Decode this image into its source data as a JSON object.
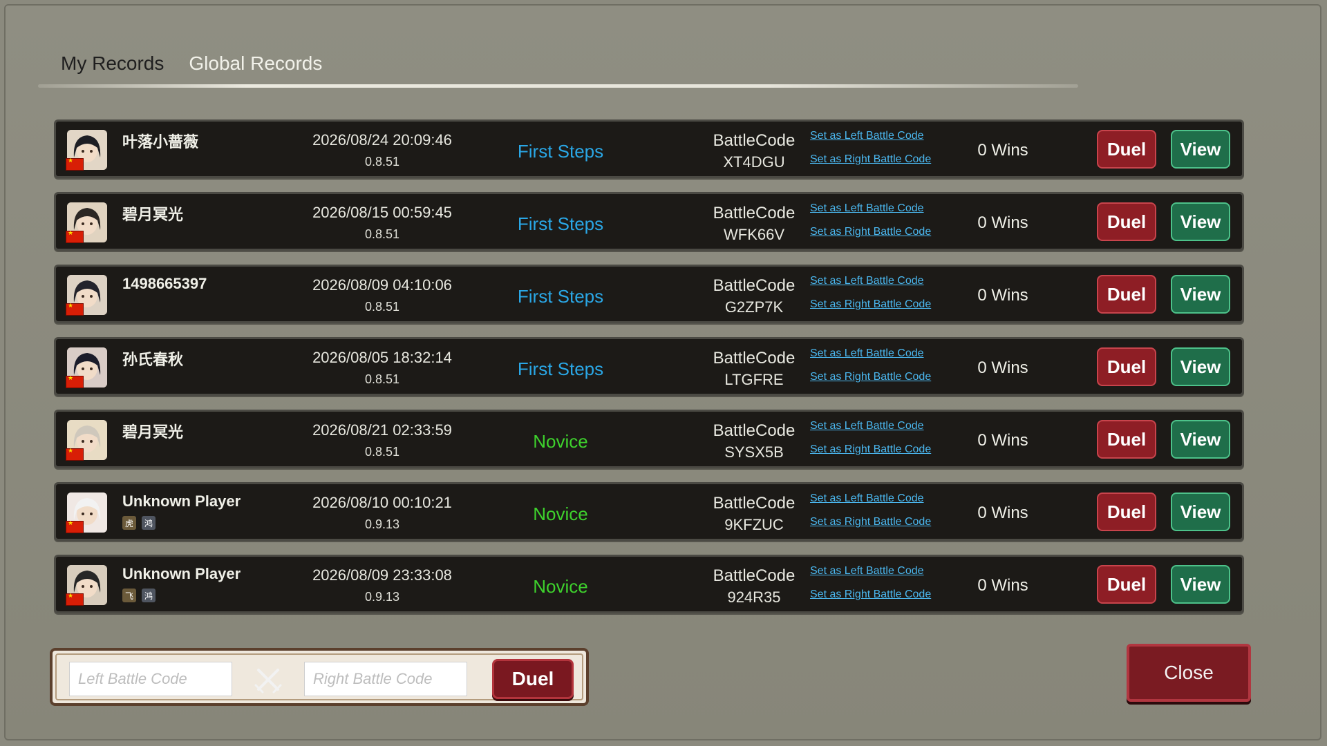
{
  "tabs": [
    {
      "label": "My Records",
      "active": true
    },
    {
      "label": "Global Records",
      "active": false
    }
  ],
  "records": [
    {
      "name": "叶落小蔷薇",
      "date": "2026/08/24 20:09:46",
      "version": "0.8.51",
      "rank": "First Steps",
      "rank_color": "#2aa7e6",
      "code_label": "BattleCode",
      "code": "XT4DGU",
      "set_left": "Set as Left Battle Code",
      "set_right": "Set as Right Battle Code",
      "wins": "0 Wins",
      "duel": "Duel",
      "view": "View",
      "avatar_bg": "#e2d6c6",
      "hair": "#1e1e24",
      "badges": []
    },
    {
      "name": "碧月冥光",
      "date": "2026/08/15 00:59:45",
      "version": "0.8.51",
      "rank": "First Steps",
      "rank_color": "#2aa7e6",
      "code_label": "BattleCode",
      "code": "WFK66V",
      "set_left": "Set as Left Battle Code",
      "set_right": "Set as Right Battle Code",
      "wins": "0 Wins",
      "duel": "Duel",
      "view": "View",
      "avatar_bg": "#e0d3c0",
      "hair": "#2b2724",
      "badges": []
    },
    {
      "name": "1498665397",
      "date": "2026/08/09 04:10:06",
      "version": "0.8.51",
      "rank": "First Steps",
      "rank_color": "#2aa7e6",
      "code_label": "BattleCode",
      "code": "G2ZP7K",
      "set_left": "Set as Left Battle Code",
      "set_right": "Set as Right Battle Code",
      "wins": "0 Wins",
      "duel": "Duel",
      "view": "View",
      "avatar_bg": "#ddd2c4",
      "hair": "#23232b",
      "badges": []
    },
    {
      "name": "孙氏春秋",
      "date": "2026/08/05 18:32:14",
      "version": "0.8.51",
      "rank": "First Steps",
      "rank_color": "#2aa7e6",
      "code_label": "BattleCode",
      "code": "LTGFRE",
      "set_left": "Set as Left Battle Code",
      "set_right": "Set as Right Battle Code",
      "wins": "0 Wins",
      "duel": "Duel",
      "view": "View",
      "avatar_bg": "#d9ccc6",
      "hair": "#1b1c2a",
      "badges": []
    },
    {
      "name": "碧月冥光",
      "date": "2026/08/21 02:33:59",
      "version": "0.8.51",
      "rank": "Novice",
      "rank_color": "#3ed22d",
      "code_label": "BattleCode",
      "code": "SYSX5B",
      "set_left": "Set as Left Battle Code",
      "set_right": "Set as Right Battle Code",
      "wins": "0 Wins",
      "duel": "Duel",
      "view": "View",
      "avatar_bg": "#e8dcc4",
      "hair": "#cfc8bc",
      "badges": []
    },
    {
      "name": "Unknown Player",
      "date": "2026/08/10 00:10:21",
      "version": "0.9.13",
      "rank": "Novice",
      "rank_color": "#3ed22d",
      "code_label": "BattleCode",
      "code": "9KFZUC",
      "set_left": "Set as Left Battle Code",
      "set_right": "Set as Right Battle Code",
      "wins": "0 Wins",
      "duel": "Duel",
      "view": "View",
      "avatar_bg": "#f0e8e4",
      "hair": "#f2f2f2",
      "badges": [
        {
          "glyph": "虎",
          "cls": "b1"
        },
        {
          "glyph": "鸿",
          "cls": "b2"
        }
      ]
    },
    {
      "name": "Unknown Player",
      "date": "2026/08/09 23:33:08",
      "version": "0.9.13",
      "rank": "Novice",
      "rank_color": "#3ed22d",
      "code_label": "BattleCode",
      "code": "924R35",
      "set_left": "Set as Left Battle Code",
      "set_right": "Set as Right Battle Code",
      "wins": "0 Wins",
      "duel": "Duel",
      "view": "View",
      "avatar_bg": "#d8cdbd",
      "hair": "#262626",
      "badges": [
        {
          "glyph": "飞",
          "cls": "b1"
        },
        {
          "glyph": "鸿",
          "cls": "b2"
        }
      ]
    }
  ],
  "bottom": {
    "left_placeholder": "Left Battle Code",
    "right_placeholder": "Right Battle Code",
    "duel_label": "Duel",
    "close_label": "Close"
  }
}
